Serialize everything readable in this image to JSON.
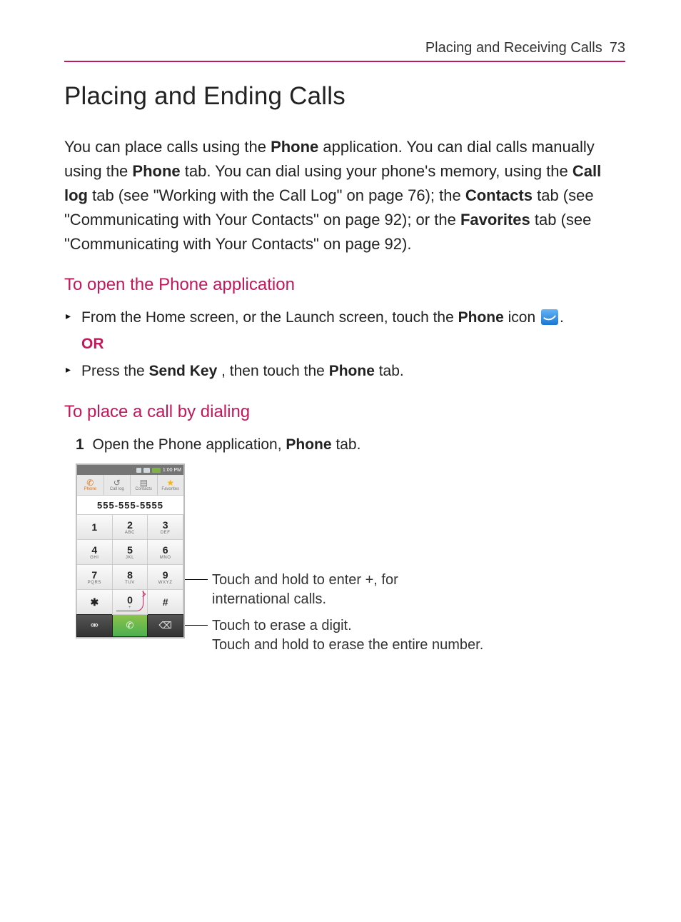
{
  "header": {
    "section": "Placing and Receiving Calls",
    "page_number": "73"
  },
  "title": "Placing and Ending Calls",
  "intro": {
    "p1a": "You can place calls using the ",
    "phone_b": "Phone",
    "p1b": " application. You can dial calls manually using the ",
    "p1c": " tab. You can dial using your phone's memory, using the ",
    "calllog_b": "Call log",
    "p1d": " tab (see \"Working with the Call Log\" on page 76); the ",
    "contacts_b": "Contacts",
    "p1e": " tab (see \"Communicating with Your Contacts\" on page 92); or the ",
    "favorites_b": "Favorites",
    "p1f": " tab (see \"Communicating with Your Contacts\" on page 92)."
  },
  "sec1": {
    "heading": "To open the Phone application",
    "step1a": "From the Home screen, or the Launch screen, touch the ",
    "step1_b": "Phone",
    "step1b": " icon ",
    "period": ".",
    "or": "OR",
    "step2a": "Press the ",
    "sendkey_b": "Send Key",
    "step2b": " , then touch the ",
    "step2c": " tab."
  },
  "sec2": {
    "heading": "To place a call by dialing",
    "num": "1",
    "step1a": " Open the Phone application, ",
    "step1_b": "Phone",
    "step1b": " tab."
  },
  "phone_mock": {
    "status_time": "1:00 PM",
    "tabs": {
      "phone": "Phone",
      "calllog": "Call log",
      "contacts": "Contacts",
      "favorites": "Favorites"
    },
    "number": "555-555-5555",
    "keys": [
      {
        "d": "1",
        "s": ""
      },
      {
        "d": "2",
        "s": "ABC"
      },
      {
        "d": "3",
        "s": "DEF"
      },
      {
        "d": "4",
        "s": "GHI"
      },
      {
        "d": "5",
        "s": "JKL"
      },
      {
        "d": "6",
        "s": "MNO"
      },
      {
        "d": "7",
        "s": "PQRS"
      },
      {
        "d": "8",
        "s": "TUV"
      },
      {
        "d": "9",
        "s": "WXYZ"
      },
      {
        "d": "✱",
        "s": ""
      },
      {
        "d": "0",
        "s": "+"
      },
      {
        "d": "#",
        "s": ""
      }
    ],
    "bottom": {
      "voicemail": "⚮",
      "call": "✆",
      "delete": "⌫"
    }
  },
  "callouts": {
    "zero1": "Touch and hold to enter +, for",
    "zero2": "international calls.",
    "del1": "Touch to erase a digit.",
    "del2": "Touch and hold to erase the entire number."
  }
}
